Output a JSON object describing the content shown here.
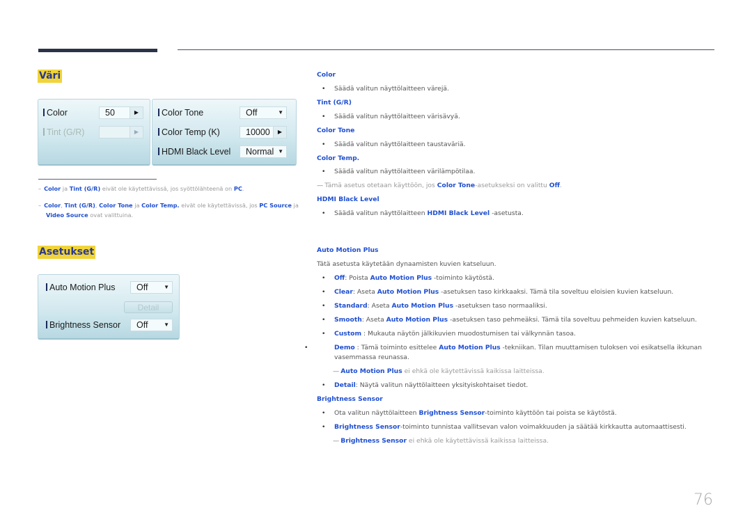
{
  "page_number": "76",
  "sections": {
    "vari": {
      "title": "Väri"
    },
    "asetukset": {
      "title": "Asetukset"
    }
  },
  "color_panel": {
    "left_rows": [
      {
        "label": "Color",
        "value": "50",
        "control": "arrow-right",
        "enabled": true
      },
      {
        "label": "Tint (G/R)",
        "value": "",
        "control": "arrow-right",
        "enabled": false
      }
    ],
    "right_rows": [
      {
        "label": "Color Tone",
        "value": "Off",
        "control": "dropdown"
      },
      {
        "label": "Color Temp (K)",
        "value": "10000",
        "control": "arrow-right"
      },
      {
        "label": "HDMI Black Level",
        "value": "Normal",
        "control": "dropdown"
      }
    ]
  },
  "settings_panel": {
    "rows": [
      {
        "label": "Auto Motion Plus",
        "value": "Off",
        "control": "dropdown"
      },
      {
        "label": "Brightness Sensor",
        "value": "Off",
        "control": "dropdown"
      }
    ],
    "detail_button": "Detail"
  },
  "footnotes": [
    {
      "parts": [
        [
          "b",
          "Color"
        ],
        [
          "t",
          " ja "
        ],
        [
          "b",
          "Tint (G/R)"
        ],
        [
          "t",
          " eivät ole käytettävissä, jos syöttölähteenä on "
        ],
        [
          "b",
          "PC"
        ],
        [
          "t",
          "."
        ]
      ]
    },
    {
      "parts": [
        [
          "b",
          "Color"
        ],
        [
          "t",
          ", "
        ],
        [
          "b",
          "Tint (G/R)"
        ],
        [
          "t",
          ", "
        ],
        [
          "b",
          "Color Tone"
        ],
        [
          "t",
          " ja "
        ],
        [
          "b",
          "Color Temp."
        ],
        [
          "t",
          " eivät ole käytettävissä, jos "
        ],
        [
          "b",
          "PC Source"
        ],
        [
          "t",
          " ja "
        ],
        [
          "b",
          "Video Source"
        ],
        [
          "t",
          " ovat valittuina."
        ]
      ]
    }
  ],
  "descriptions": {
    "color": {
      "heading": "Color",
      "bullet": "Säädä valitun näyttölaitteen värejä."
    },
    "tint": {
      "heading": "Tint (G/R)",
      "bullet": "Säädä valitun näyttölaitteen värisävyä."
    },
    "color_tone": {
      "heading": "Color Tone",
      "bullet": "Säädä valitun näyttölaitteen taustaväriä."
    },
    "color_temp": {
      "heading": "Color Temp.",
      "bullet": "Säädä valitun näyttölaitteen värilämpötilaa.",
      "note": [
        [
          "t",
          "Tämä asetus otetaan käyttöön, jos "
        ],
        [
          "b",
          "Color Tone"
        ],
        [
          "t",
          "-asetukseksi on valittu "
        ],
        [
          "b",
          "Off"
        ],
        [
          "t",
          "."
        ]
      ]
    },
    "hdmi": {
      "heading": "HDMI Black Level",
      "bullet": [
        [
          "t",
          "Säädä valitun näyttölaitteen "
        ],
        [
          "b",
          "HDMI Black Level"
        ],
        [
          "t",
          " -asetusta."
        ]
      ]
    },
    "amp": {
      "heading": "Auto Motion Plus",
      "intro": "Tätä asetusta käytetään dynaamisten kuvien katseluun.",
      "bullets": [
        [
          [
            "b",
            "Off"
          ],
          [
            "t",
            ": Poista "
          ],
          [
            "b",
            "Auto Motion Plus"
          ],
          [
            "t",
            " -toiminto käytöstä."
          ]
        ],
        [
          [
            "b",
            "Clear"
          ],
          [
            "t",
            ": Aseta "
          ],
          [
            "b",
            "Auto Motion Plus"
          ],
          [
            "t",
            " -asetuksen taso kirkkaaksi. Tämä tila soveltuu eloisien kuvien katseluun."
          ]
        ],
        [
          [
            "b",
            "Standard"
          ],
          [
            "t",
            ": Aseta "
          ],
          [
            "b",
            "Auto Motion Plus"
          ],
          [
            "t",
            " -asetuksen taso normaaliksi."
          ]
        ],
        [
          [
            "b",
            "Smooth"
          ],
          [
            "t",
            ": Aseta "
          ],
          [
            "b",
            "Auto Motion Plus"
          ],
          [
            "t",
            " -asetuksen taso pehmeäksi. Tämä tila soveltuu pehmeiden kuvien katseluun."
          ]
        ],
        [
          [
            "b",
            "Custom"
          ],
          [
            "t",
            " : Mukauta näytön jälkikuvien muodostumisen tai välkynnän tasoa."
          ]
        ],
        [
          [
            "b",
            "Demo"
          ],
          [
            "t",
            " : Tämä toiminto esittelee "
          ],
          [
            "b",
            "Auto Motion Plus"
          ],
          [
            "t",
            " -tekniikan. Tilan muuttamisen tuloksen voi esikatsella ikkunan vasemmassa reunassa."
          ]
        ]
      ],
      "note": [
        [
          "b",
          "Auto Motion Plus"
        ],
        [
          "t",
          " ei ehkä ole käytettävissä kaikissa laitteissa."
        ]
      ],
      "detail_bullet": [
        [
          "b",
          "Detail"
        ],
        [
          "t",
          ": Näytä valitun näyttölaitteen yksityiskohtaiset tiedot."
        ]
      ]
    },
    "brightness": {
      "heading": "Brightness Sensor",
      "bullets": [
        [
          [
            "t",
            "Ota valitun näyttölaitteen "
          ],
          [
            "b",
            "Brightness Sensor"
          ],
          [
            "t",
            "-toiminto käyttöön tai poista se käytöstä."
          ]
        ],
        [
          [
            "b",
            "Brightness Sensor"
          ],
          [
            "t",
            "-toiminto tunnistaa vallitsevan valon voimakkuuden ja säätää kirkkautta automaattisesti."
          ]
        ]
      ],
      "note": [
        [
          "b",
          "Brightness Sensor"
        ],
        [
          "t",
          " ei ehkä ole käytettävissä kaikissa laitteissa."
        ]
      ]
    }
  },
  "colors": {
    "accent_blue": "#1f4fd0",
    "title_highlight": "#f0d43a",
    "title_text": "#2b3a8c"
  }
}
